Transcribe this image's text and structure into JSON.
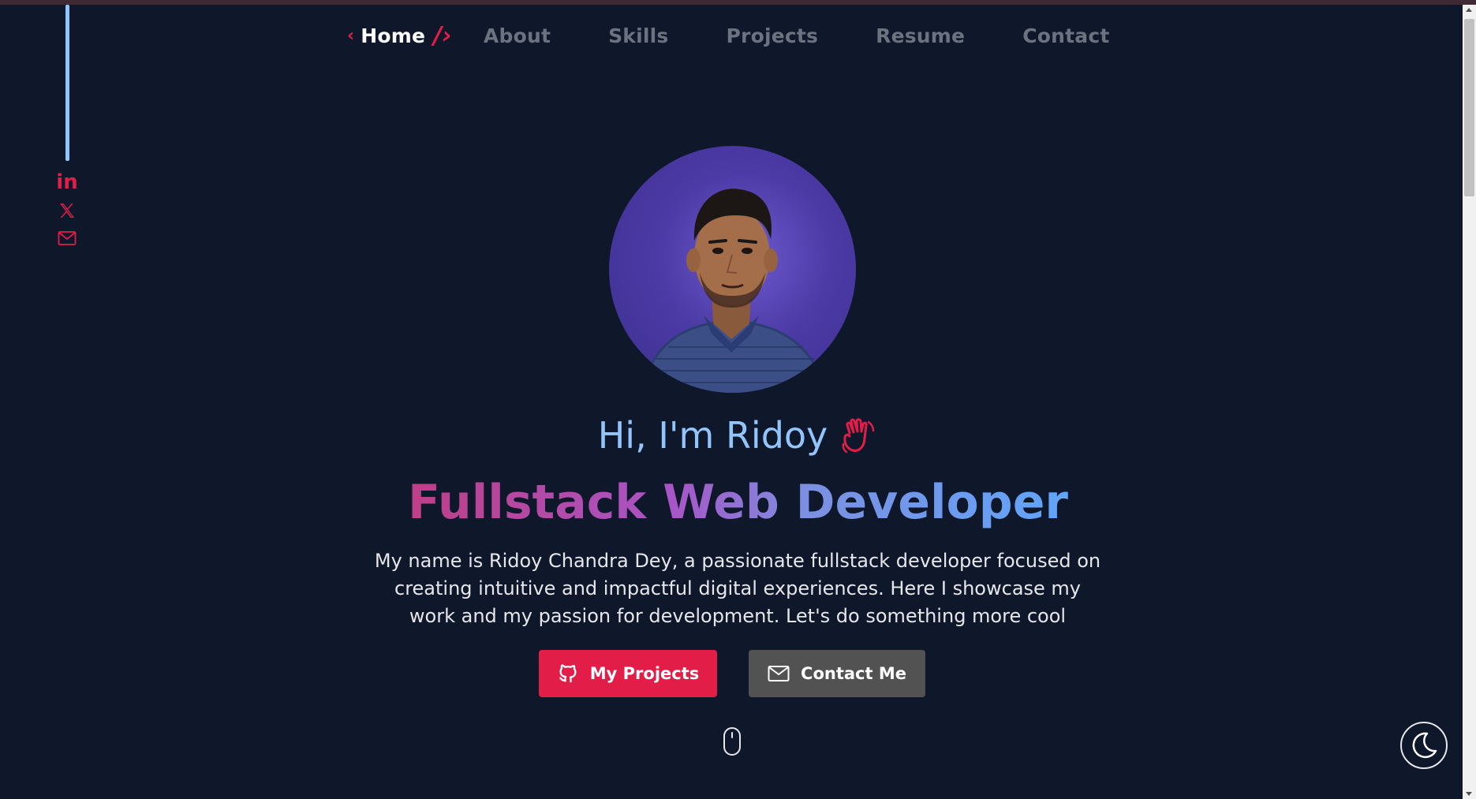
{
  "nav": {
    "home_label": "Home",
    "home_bracket_left": "‹",
    "home_bracket_right": "/›",
    "items": [
      {
        "label": "About"
      },
      {
        "label": "Skills"
      },
      {
        "label": "Projects"
      },
      {
        "label": "Resume"
      },
      {
        "label": "Contact"
      }
    ]
  },
  "social": {
    "linkedin_text": "in",
    "icons": [
      "linkedin-icon",
      "x-icon",
      "mail-icon"
    ],
    "color": "#e11d48"
  },
  "hero": {
    "greeting": "Hi, I'm Ridoy",
    "role": "Fullstack Web Developer",
    "bio": "My name is Ridoy Chandra Dey, a passionate fullstack developer focused on creating intuitive and impactful digital experiences. Here I showcase my work and my passion for development. Let's do something more cool"
  },
  "buttons": {
    "projects_label": "My Projects",
    "contact_label": "Contact Me"
  },
  "colors": {
    "background": "#0f172a",
    "accent": "#e11d48",
    "greeting": "#93c5fd",
    "rail": "#93c5fd"
  }
}
